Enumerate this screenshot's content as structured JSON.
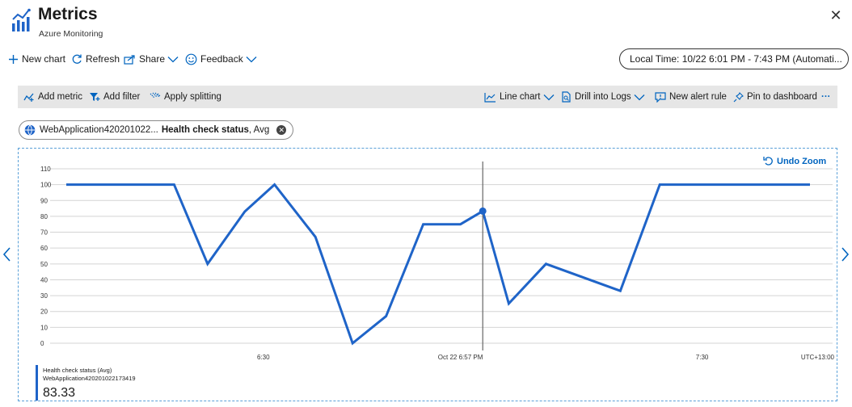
{
  "header": {
    "title": "Metrics",
    "subtitle": "Azure Monitoring",
    "close_label": "✕"
  },
  "commands": {
    "new_chart": "New chart",
    "refresh": "Refresh",
    "share": "Share",
    "feedback": "Feedback",
    "time_range": "Local Time: 10/22 6:01 PM - 7:43 PM (Automati..."
  },
  "toolbar": {
    "add_metric": "Add metric",
    "add_filter": "Add filter",
    "apply_splitting": "Apply splitting",
    "line_chart": "Line chart",
    "drill_into_logs": "Drill into Logs",
    "new_alert_rule": "New alert rule",
    "pin_to_dashboard": "Pin to dashboard",
    "more": "···"
  },
  "metric_pill": {
    "resource": "WebApplication420201022...",
    "metric": "Health check status",
    "aggregation": ", Avg"
  },
  "chart": {
    "undo_zoom": "Undo Zoom"
  },
  "legend": {
    "name": "Health check status (Avg)",
    "resource": "WebApplication420201022173419",
    "value": "83.33"
  },
  "colors": {
    "series": "#1f64c8",
    "accent": "#0064bf",
    "toolbar_bg": "#e6e6e6"
  },
  "chart_data": {
    "type": "line",
    "ylim": [
      0,
      110
    ],
    "y_ticks": [
      0,
      10,
      20,
      30,
      40,
      50,
      60,
      70,
      80,
      90,
      100,
      110
    ],
    "x_ticks": [
      "6:30",
      "Oct 22 6:57 PM",
      "7:30"
    ],
    "x_tick_positions": [
      0.265,
      0.53,
      0.855
    ],
    "timezone_label": "UTC+13:00",
    "grid": true,
    "cursor_index": 10,
    "series": [
      {
        "name": "Health check status (Avg)",
        "x_fraction": [
          0,
          0.145,
          0.19,
          0.24,
          0.28,
          0.335,
          0.385,
          0.43,
          0.48,
          0.53,
          0.56,
          0.595,
          0.645,
          0.745,
          0.798,
          0.85,
          1.0
        ],
        "values": [
          100,
          100,
          50,
          83,
          100,
          67,
          0,
          17,
          75,
          75,
          83.33,
          25,
          50,
          33,
          100,
          100,
          100
        ]
      }
    ]
  }
}
